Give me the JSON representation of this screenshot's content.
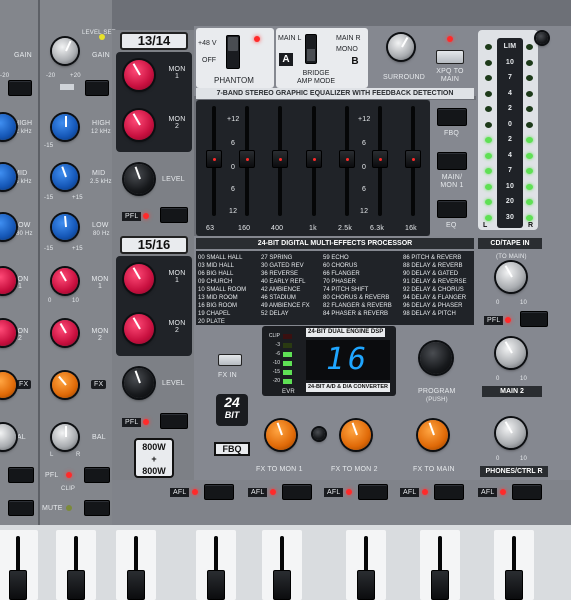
{
  "channel_left": {
    "level_set_label": "LEVEL SET",
    "gain_label": "GAIN",
    "gain_scale": [
      "-20",
      "+20"
    ],
    "eq_high_label": "HIGH",
    "eq_high_freq": "12 kHz",
    "eq_mid_label": "MID",
    "eq_mid_freq": "2.5 kHz",
    "eq_low_label": "LOW",
    "eq_low_freq": "80 Hz",
    "eq_scale": [
      "-15",
      "+15"
    ],
    "mon1_label": "MON 1",
    "mon2_label": "MON 2",
    "fx_label": "FX",
    "bal_label": "BAL",
    "bal_scale": [
      "L",
      "R"
    ],
    "pfl_label": "PFL",
    "clip_label": "CLIP",
    "mute_label": "MUTE",
    "scale_0": "0",
    "scale_10": "10"
  },
  "stereo_13_14": {
    "title": "13/14",
    "mon1": "MON 1",
    "mon2": "MON 2",
    "level": "LEVEL",
    "pfl": "PFL"
  },
  "stereo_15_16": {
    "title": "15/16",
    "mon1": "MON 1",
    "mon2": "MON 2",
    "level": "LEVEL",
    "pfl": "PFL",
    "power": [
      "800W",
      "+",
      "800W"
    ]
  },
  "phantom": {
    "on_label": "+48 V",
    "off_label": "OFF",
    "label": "PHANTOM"
  },
  "bridge": {
    "main_l": "MAIN L",
    "main_r": "MAIN R",
    "mono": "MONO",
    "label": "BRIDGE AMP MODE",
    "a": "A",
    "b": "B"
  },
  "surround_label": "SURROUND",
  "xpq_label": "XPQ TO MAIN",
  "geq": {
    "title": "7-BAND STEREO GRAPHIC EQUALIZER WITH FEEDBACK DETECTION",
    "scale": [
      "+12",
      "6",
      "0",
      "6",
      "12"
    ],
    "bands": [
      "63",
      "160",
      "400",
      "1k",
      "2.5k",
      "6.3k",
      "16k"
    ],
    "fbq_label": "FBQ",
    "main_mon_label": "MAIN/ MON 1",
    "eq_label": "EQ"
  },
  "meter": {
    "labels": [
      "LIM",
      "10",
      "7",
      "4",
      "2",
      "0",
      "2",
      "4",
      "7",
      "10",
      "20",
      "30"
    ],
    "l": "L",
    "r": "R"
  },
  "fx": {
    "title": "24-BIT DIGITAL MULTI-EFFECTS PROCESSOR",
    "presets_col1": [
      "00 SMALL HALL",
      "03 MID HALL",
      "06 BIG HALL",
      "09 CHURCH",
      "10 SMALL ROOM",
      "13 MID ROOM",
      "16 BIG ROOM",
      "19 CHAPEL",
      "20 PLATE"
    ],
    "presets_col2": [
      "27 SPRING",
      "30 GATED REV",
      "36 REVERSE",
      "40 EARLY REFL",
      "42 AMBIENCE",
      "46 STADIUM",
      "49 AMBIENCE FX",
      "52 DELAY",
      ""
    ],
    "presets_col3": [
      "59 ECHO",
      "60 CHORUS",
      "66 FLANGER",
      "70 PHASER",
      "74 PITCH SHIFT",
      "80 CHORUS & REVERB",
      "82 FLANGER & REVERB",
      "84 PHASER & REVERB",
      ""
    ],
    "presets_col4": [
      "86 PITCH & REVERB",
      "88 DELAY & REVERB",
      "90 DELAY & GATED",
      "91 DELAY & REVERSE",
      "92 DELAY & CHORUS",
      "94 DELAY & FLANGER",
      "96 DELAY & PHASER",
      "98 DELAY & PITCH",
      ""
    ],
    "dsp_label": "24-BIT DUAL ENGINE DSP",
    "converter_label": "24-BIT A/D & D/A CONVERTER",
    "display_value": "16",
    "level_labels": [
      "CLIP",
      "-3",
      "-6",
      "-10",
      "-15",
      "-20"
    ],
    "evr_label": "EVR",
    "fx_in_label": "FX IN",
    "program_label": "PROGRAM",
    "push_label": "(PUSH)",
    "badge_24": "24",
    "badge_bit": "BIT",
    "fbq_badge": "FBQ",
    "to_mon1": "FX TO MON 1",
    "to_mon2": "FX TO MON 2",
    "to_main": "FX TO MAIN"
  },
  "cd_tape": {
    "title": "CD/TAPE IN",
    "to_main": "(TO MAIN)",
    "pfl": "PFL",
    "main2": "MAIN 2",
    "phones": "PHONES/CTRL R"
  },
  "afl_label": "AFL"
}
